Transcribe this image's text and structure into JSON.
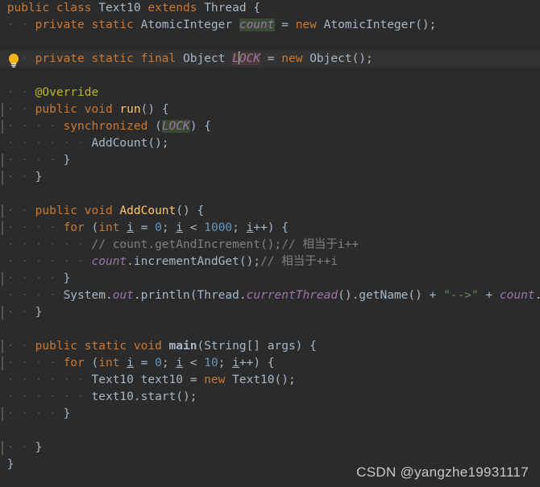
{
  "editor": {
    "theme": "darcula",
    "background_color": "#2b2b2b",
    "caret_line_color": "#323232",
    "default_text_color": "#a9b7c6",
    "language": "Java",
    "class_name": "Text10"
  },
  "colors": {
    "keyword": "#cc7832",
    "number": "#6897bb",
    "string": "#6a8759",
    "comment": "#808080",
    "annotation": "#bbb529",
    "static_field": "#9876aa",
    "method_name": "#ffc66d",
    "identifier": "#a9b7c6",
    "read_highlight": "#3a4a33",
    "write_highlight": "#4b3a33",
    "indent_guide": "#555555",
    "bulb_yellow": "#f5b315"
  },
  "gutter": {
    "bulb_icon": "lightbulb-icon",
    "bulb_tooltip": "Show Context Actions"
  },
  "code": {
    "lines": [
      {
        "n": 1,
        "indent": 0,
        "guide": false,
        "caret": false,
        "tokens": [
          {
            "t": "public ",
            "c": "kw"
          },
          {
            "t": "class ",
            "c": "kw"
          },
          {
            "t": "Text10",
            "c": "cls"
          },
          {
            "t": " ",
            "c": "plain"
          },
          {
            "t": "extends ",
            "c": "kw"
          },
          {
            "t": "Thread",
            "c": "cls"
          },
          {
            "t": " {",
            "c": "plain"
          }
        ]
      },
      {
        "n": 2,
        "indent": 1,
        "guide": false,
        "caret": false,
        "tokens": [
          {
            "t": "private ",
            "c": "kw"
          },
          {
            "t": "static ",
            "c": "kw"
          },
          {
            "t": "AtomicInteger",
            "c": "cls"
          },
          {
            "t": " ",
            "c": "plain"
          },
          {
            "t": "count",
            "c": "sfield",
            "hl": "read"
          },
          {
            "t": " = ",
            "c": "plain"
          },
          {
            "t": "new ",
            "c": "kw"
          },
          {
            "t": "AtomicInteger",
            "c": "cls"
          },
          {
            "t": "();",
            "c": "plain"
          }
        ]
      },
      {
        "n": 3,
        "indent": 0,
        "guide": false,
        "caret": false,
        "tokens": []
      },
      {
        "n": 4,
        "indent": 1,
        "guide": false,
        "caret": true,
        "tokens": [
          {
            "t": "private ",
            "c": "kw"
          },
          {
            "t": "static ",
            "c": "kw"
          },
          {
            "t": "final ",
            "c": "kw"
          },
          {
            "t": "Object",
            "c": "cls"
          },
          {
            "t": " ",
            "c": "plain"
          },
          {
            "t": "L",
            "c": "sfield",
            "hl": "write"
          },
          {
            "t": "CARET",
            "c": "caret"
          },
          {
            "t": "OCK",
            "c": "sfield",
            "hl": "write"
          },
          {
            "t": " = ",
            "c": "plain"
          },
          {
            "t": "new ",
            "c": "kw"
          },
          {
            "t": "Object",
            "c": "cls"
          },
          {
            "t": "();",
            "c": "plain"
          }
        ]
      },
      {
        "n": 5,
        "indent": 0,
        "guide": false,
        "caret": false,
        "tokens": []
      },
      {
        "n": 6,
        "indent": 1,
        "guide": false,
        "caret": false,
        "tokens": [
          {
            "t": "@Override",
            "c": "anno"
          }
        ]
      },
      {
        "n": 7,
        "indent": 1,
        "guide": true,
        "caret": false,
        "tokens": [
          {
            "t": "public ",
            "c": "kw"
          },
          {
            "t": "void ",
            "c": "kw"
          },
          {
            "t": "run",
            "c": "mname"
          },
          {
            "t": "() {",
            "c": "plain"
          }
        ]
      },
      {
        "n": 8,
        "indent": 2,
        "guide": true,
        "caret": false,
        "tokens": [
          {
            "t": "synchronized ",
            "c": "kw"
          },
          {
            "t": "(",
            "c": "plain"
          },
          {
            "t": "LOCK",
            "c": "sfield",
            "hl": "read"
          },
          {
            "t": ") {",
            "c": "plain"
          }
        ]
      },
      {
        "n": 9,
        "indent": 3,
        "guide": false,
        "caret": false,
        "tokens": [
          {
            "t": "AddCount",
            "c": "plain"
          },
          {
            "t": "();",
            "c": "plain"
          }
        ]
      },
      {
        "n": 10,
        "indent": 2,
        "guide": true,
        "caret": false,
        "tokens": [
          {
            "t": "}",
            "c": "plain"
          }
        ]
      },
      {
        "n": 11,
        "indent": 1,
        "guide": true,
        "caret": false,
        "tokens": [
          {
            "t": "}",
            "c": "plain"
          }
        ]
      },
      {
        "n": 12,
        "indent": 0,
        "guide": false,
        "caret": false,
        "tokens": []
      },
      {
        "n": 13,
        "indent": 1,
        "guide": true,
        "caret": false,
        "tokens": [
          {
            "t": "public ",
            "c": "kw"
          },
          {
            "t": "void ",
            "c": "kw"
          },
          {
            "t": "AddCount",
            "c": "mname"
          },
          {
            "t": "() {",
            "c": "plain"
          }
        ]
      },
      {
        "n": 14,
        "indent": 2,
        "guide": true,
        "caret": false,
        "tokens": [
          {
            "t": "for ",
            "c": "kw"
          },
          {
            "t": "(",
            "c": "plain"
          },
          {
            "t": "int ",
            "c": "kw"
          },
          {
            "t": "i",
            "c": "local"
          },
          {
            "t": " = ",
            "c": "plain"
          },
          {
            "t": "0",
            "c": "num"
          },
          {
            "t": "; ",
            "c": "plain"
          },
          {
            "t": "i",
            "c": "local"
          },
          {
            "t": " < ",
            "c": "plain"
          },
          {
            "t": "1000",
            "c": "num"
          },
          {
            "t": "; ",
            "c": "plain"
          },
          {
            "t": "i",
            "c": "local"
          },
          {
            "t": "++) {",
            "c": "plain"
          }
        ]
      },
      {
        "n": 15,
        "indent": 3,
        "guide": false,
        "caret": false,
        "tokens": [
          {
            "t": "// count.getAndIncrement();// 相当于i++",
            "c": "cmt"
          }
        ]
      },
      {
        "n": 16,
        "indent": 3,
        "guide": false,
        "caret": false,
        "tokens": [
          {
            "t": "count",
            "c": "sfield"
          },
          {
            "t": ".incrementAndGet",
            "c": "plain"
          },
          {
            "t": "();",
            "c": "plain"
          },
          {
            "t": "// 相当于++i",
            "c": "cmt"
          }
        ]
      },
      {
        "n": 17,
        "indent": 2,
        "guide": true,
        "caret": false,
        "tokens": [
          {
            "t": "}",
            "c": "plain"
          }
        ]
      },
      {
        "n": 18,
        "indent": 2,
        "guide": false,
        "caret": false,
        "tokens": [
          {
            "t": "System",
            "c": "cls"
          },
          {
            "t": ".",
            "c": "plain"
          },
          {
            "t": "out",
            "c": "sfield"
          },
          {
            "t": ".println(",
            "c": "plain"
          },
          {
            "t": "Thread",
            "c": "cls"
          },
          {
            "t": ".",
            "c": "plain"
          },
          {
            "t": "currentThread",
            "c": "sfield"
          },
          {
            "t": "().getName() + ",
            "c": "plain"
          },
          {
            "t": "\"-->\"",
            "c": "str"
          },
          {
            "t": " + ",
            "c": "plain"
          },
          {
            "t": "count",
            "c": "sfield"
          },
          {
            "t": ".get());",
            "c": "plain"
          }
        ]
      },
      {
        "n": 19,
        "indent": 1,
        "guide": true,
        "caret": false,
        "tokens": [
          {
            "t": "}",
            "c": "plain"
          }
        ]
      },
      {
        "n": 20,
        "indent": 0,
        "guide": false,
        "caret": false,
        "tokens": []
      },
      {
        "n": 21,
        "indent": 1,
        "guide": true,
        "caret": false,
        "tokens": [
          {
            "t": "public ",
            "c": "kw"
          },
          {
            "t": "static ",
            "c": "kw"
          },
          {
            "t": "void ",
            "c": "kw"
          },
          {
            "t": "main",
            "c": "bold"
          },
          {
            "t": "(",
            "c": "plain"
          },
          {
            "t": "String",
            "c": "cls"
          },
          {
            "t": "[] args) {",
            "c": "plain"
          }
        ]
      },
      {
        "n": 22,
        "indent": 2,
        "guide": true,
        "caret": false,
        "tokens": [
          {
            "t": "for ",
            "c": "kw"
          },
          {
            "t": "(",
            "c": "plain"
          },
          {
            "t": "int ",
            "c": "kw"
          },
          {
            "t": "i",
            "c": "local"
          },
          {
            "t": " = ",
            "c": "plain"
          },
          {
            "t": "0",
            "c": "num"
          },
          {
            "t": "; ",
            "c": "plain"
          },
          {
            "t": "i",
            "c": "local"
          },
          {
            "t": " < ",
            "c": "plain"
          },
          {
            "t": "10",
            "c": "num"
          },
          {
            "t": "; ",
            "c": "plain"
          },
          {
            "t": "i",
            "c": "local"
          },
          {
            "t": "++) {",
            "c": "plain"
          }
        ]
      },
      {
        "n": 23,
        "indent": 3,
        "guide": false,
        "caret": false,
        "tokens": [
          {
            "t": "Text10",
            "c": "cls"
          },
          {
            "t": " text10 = ",
            "c": "plain"
          },
          {
            "t": "new ",
            "c": "kw"
          },
          {
            "t": "Text10",
            "c": "cls"
          },
          {
            "t": "();",
            "c": "plain"
          }
        ]
      },
      {
        "n": 24,
        "indent": 3,
        "guide": false,
        "caret": false,
        "tokens": [
          {
            "t": "text10.start();",
            "c": "plain"
          }
        ]
      },
      {
        "n": 25,
        "indent": 2,
        "guide": true,
        "caret": false,
        "tokens": [
          {
            "t": "}",
            "c": "plain"
          }
        ]
      },
      {
        "n": 26,
        "indent": 0,
        "guide": false,
        "caret": false,
        "tokens": []
      },
      {
        "n": 27,
        "indent": 1,
        "guide": true,
        "caret": false,
        "tokens": [
          {
            "t": "}",
            "c": "plain"
          }
        ]
      },
      {
        "n": 28,
        "indent": 0,
        "guide": false,
        "caret": false,
        "tokens": [
          {
            "t": "}",
            "c": "plain"
          }
        ]
      }
    ]
  },
  "watermark": {
    "text": "CSDN @yangzhe19931117"
  }
}
